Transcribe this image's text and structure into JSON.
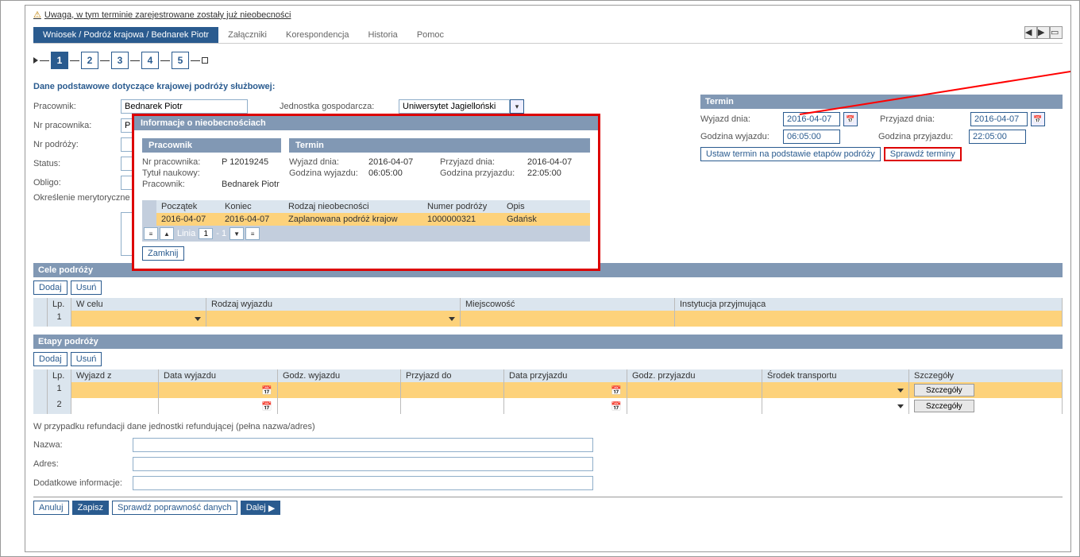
{
  "warning": {
    "text": "Uwaga, w tym terminie zarejestrowane zostały już nieobecności"
  },
  "tabs": {
    "main": "Wniosek / Podróż krajowa / Bednarek Piotr",
    "attachments": "Załączniki",
    "correspondence": "Korespondencja",
    "history": "Historia",
    "help": "Pomoc"
  },
  "steps": [
    "1",
    "2",
    "3",
    "4",
    "5"
  ],
  "heading": "Dane podstawowe dotyczące krajowej podróży służbowej:",
  "fields": {
    "pracownik_label": "Pracownik:",
    "pracownik_value": "Bednarek Piotr",
    "jednostka_label": "Jednostka gospodarcza:",
    "jednostka_value": "Uniwersytet Jagielloński",
    "nrprac_label": "Nr pracownika:",
    "nrprac_value": "P 12",
    "nrpodrozy_label": "Nr podróży:",
    "status_label": "Status:",
    "obligo_label": "Obligo:",
    "okreslenie_label": "Określenie merytoryczne"
  },
  "termin_panel": {
    "header": "Termin",
    "wyjazd_dnia_label": "Wyjazd dnia:",
    "wyjazd_dnia_value": "2016-04-07",
    "przyjazd_dnia_label": "Przyjazd dnia:",
    "przyjazd_dnia_value": "2016-04-07",
    "godzina_wyjazdu_label": "Godzina wyjazdu:",
    "godzina_wyjazdu_value": "06:05:00",
    "godzina_przyjazdu_label": "Godzina przyjazdu:",
    "godzina_przyjazdu_value": "22:05:00",
    "btn_ustaw": "Ustaw termin na podstawie etapów podróży",
    "btn_sprawdz": "Sprawdź terminy"
  },
  "cele": {
    "header": "Cele podróży",
    "dodaj": "Dodaj",
    "usun": "Usuń",
    "cols": {
      "lp": "Lp.",
      "wcelu": "W celu",
      "rodzaj": "Rodzaj wyjazdu",
      "miejsc": "Miejscowość",
      "inst": "Instytucja przyjmująca"
    },
    "row_lp": "1"
  },
  "etapy": {
    "header": "Etapy podróży",
    "dodaj": "Dodaj",
    "usun": "Usuń",
    "cols": {
      "lp": "Lp.",
      "wyjazdz": "Wyjazd z",
      "dataw": "Data wyjazdu",
      "godzw": "Godz. wyjazdu",
      "przyjazddo": "Przyjazd do",
      "datap": "Data przyjazdu",
      "godzp": "Godz. przyjazdu",
      "srodek": "Środek transportu",
      "szcz": "Szczegóły"
    },
    "row1_lp": "1",
    "row2_lp": "2",
    "szczegoly_btn": "Szczegóły"
  },
  "refund": {
    "heading": "W przypadku refundacji dane jednostki refundującej (pełna nazwa/adres)",
    "nazwa_label": "Nazwa:",
    "adres_label": "Adres:",
    "dodatkowe_label": "Dodatkowe informacje:"
  },
  "footer": {
    "anuluj": "Anuluj",
    "zapisz": "Zapisz",
    "sprawdz": "Sprawdź poprawność danych",
    "dalej": "Dalej"
  },
  "modal": {
    "header": "Informacje o nieobecnościach",
    "sec_pracownik": "Pracownik",
    "sec_termin": "Termin",
    "nrprac_label": "Nr pracownika:",
    "nrprac_value": "P 12019245",
    "tytul_label": "Tytuł naukowy:",
    "pracownik_label": "Pracownik:",
    "pracownik_value": "Bednarek Piotr",
    "wyjazd_dnia_label": "Wyjazd dnia:",
    "wyjazd_dnia_value": "2016-04-07",
    "godzina_wyjazdu_label": "Godzina wyjazdu:",
    "godzina_wyjazdu_value": "06:05:00",
    "przyjazd_dnia_label": "Przyjazd dnia:",
    "przyjazd_dnia_value": "2016-04-07",
    "godzina_przyjazdu_label": "Godzina przyjazdu:",
    "godzina_przyjazdu_value": "22:05:00",
    "cols": {
      "poczatek": "Początek",
      "koniec": "Koniec",
      "rodzaj": "Rodzaj nieobecności",
      "numer": "Numer podróży",
      "opis": "Opis"
    },
    "row": {
      "poczatek": "2016-04-07",
      "koniec": "2016-04-07",
      "rodzaj": "Zaplanowana podróż krajow",
      "numer": "1000000321",
      "opis": "Gdańsk"
    },
    "pager": {
      "linia": "Linia",
      "value": "1",
      "total": "- 1"
    },
    "zamknij": "Zamknij"
  }
}
